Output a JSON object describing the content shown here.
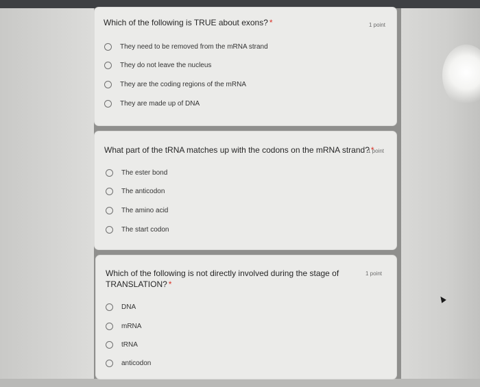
{
  "questions": [
    {
      "text": "Which of the following is TRUE about exons?",
      "required_mark": "*",
      "points": "1 point",
      "options": [
        "They need to be removed from the mRNA strand",
        "They do not leave the nucleus",
        "They are the coding regions of the mRNA",
        "They are made up of DNA"
      ]
    },
    {
      "text": "What part of the tRNA matches up with the codons on the mRNA strand?",
      "required_mark": "*",
      "points": "1 point",
      "options": [
        "The ester bond",
        "The anticodon",
        "The amino acid",
        "The start codon"
      ]
    },
    {
      "text_line1": "Which of the following is not directly involved during the stage of",
      "text_line2": "TRANSLATION?",
      "required_mark": "*",
      "points": "1 point",
      "options": [
        "DNA",
        "mRNA",
        "tRNA",
        "anticodon"
      ]
    }
  ],
  "colors": {
    "card_background": "#ebebe9",
    "required_mark": "#d93025",
    "page_background": "#8f8f8d"
  }
}
